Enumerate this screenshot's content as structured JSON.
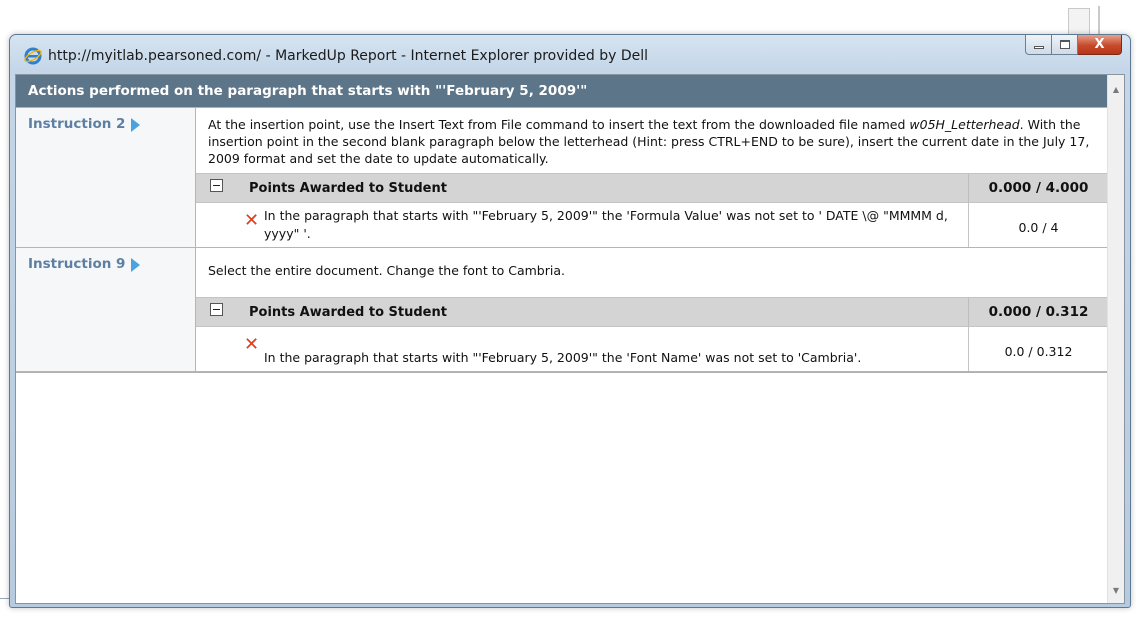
{
  "window": {
    "title": "http://myitlab.pearsoned.com/ - MarkedUp Report - Internet Explorer provided by Dell",
    "minimize_label": "",
    "close_label": "X"
  },
  "report": {
    "header": "Actions performed on the paragraph that starts with \"'February 5, 2009'\"",
    "instructions": [
      {
        "label": "Instruction 2",
        "text_before": "At the insertion point, use the Insert Text from File command to insert the text from the downloaded file named ",
        "text_italic": "w05H_Letterhead",
        "text_after": ". With the insertion point in the second blank paragraph below the letterhead (Hint: press CTRL+END to be sure), insert the current date in the July 17, 2009 format and set the date to update automatically.",
        "points_header": "Points Awarded to Student",
        "points_total": "0.000 / 4.000",
        "result_message": "In the paragraph that starts with \"'February 5, 2009'\" the 'Formula Value' was not set to ' DATE \\@ \"MMMM d, yyyy\" '.",
        "result_score": "0.0 / 4"
      },
      {
        "label": "Instruction 9",
        "text_before": "Select the entire document. Change the font to Cambria.",
        "text_italic": "",
        "text_after": "",
        "points_header": "Points Awarded to Student",
        "points_total": "0.000 / 0.312",
        "result_message": "In the paragraph that starts with \"'February 5, 2009'\" the 'Font Name' was not set to 'Cambria'.",
        "result_score": "0.0 / 0.312"
      }
    ]
  },
  "icons": {
    "browser": "internet-explorer-icon",
    "fail": "red-x-icon",
    "expand": "arrow-right-icon",
    "collapse": "minus-box-icon"
  },
  "colors": {
    "header_bg": "#5c7589",
    "instruction_label": "#5e7fa3",
    "fail_red": "#e43b1b",
    "points_header_bg": "#d4d4d4"
  }
}
